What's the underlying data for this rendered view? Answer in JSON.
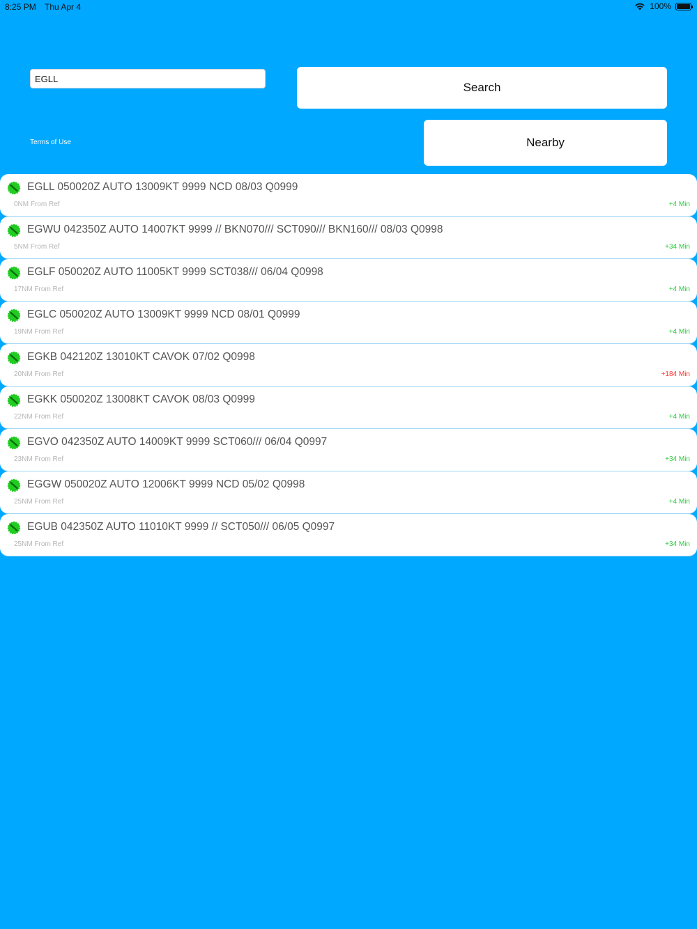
{
  "status": {
    "time": "8:25 PM",
    "date": "Thu Apr 4",
    "battery": "100%"
  },
  "search": {
    "value": "EGLL",
    "button_label": "Search"
  },
  "nearby_label": "Nearby",
  "terms_label": "Terms of Use",
  "colors": {
    "background": "#00a8ff",
    "status_ok": "#22cc22",
    "age_recent": "#2ecc40",
    "age_stale": "#ff3030"
  },
  "stations": [
    {
      "metar": "EGLL 050020Z AUTO 13009KT 9999 NCD 08/03 Q0999",
      "distance": "0NM From Ref",
      "age": "+4 Min",
      "stale": false
    },
    {
      "metar": "EGWU 042350Z AUTO 14007KT 9999 // BKN070/// SCT090/// BKN160/// 08/03 Q0998",
      "distance": "5NM From Ref",
      "age": "+34 Min",
      "stale": false
    },
    {
      "metar": "EGLF 050020Z AUTO 11005KT 9999 SCT038/// 06/04 Q0998",
      "distance": "17NM From Ref",
      "age": "+4 Min",
      "stale": false
    },
    {
      "metar": "EGLC 050020Z AUTO 13009KT 9999 NCD 08/01 Q0999",
      "distance": "19NM From Ref",
      "age": "+4 Min",
      "stale": false
    },
    {
      "metar": "EGKB 042120Z 13010KT CAVOK 07/02 Q0998",
      "distance": "20NM From Ref",
      "age": "+184 Min",
      "stale": true
    },
    {
      "metar": "EGKK 050020Z 13008KT CAVOK 08/03 Q0999",
      "distance": "22NM From Ref",
      "age": "+4 Min",
      "stale": false
    },
    {
      "metar": "EGVO 042350Z AUTO 14009KT 9999 SCT060/// 06/04 Q0997",
      "distance": "23NM From Ref",
      "age": "+34 Min",
      "stale": false
    },
    {
      "metar": "EGGW 050020Z AUTO 12006KT 9999 NCD 05/02 Q0998",
      "distance": "25NM From Ref",
      "age": "+4 Min",
      "stale": false
    },
    {
      "metar": "EGUB 042350Z AUTO 11010KT 9999 // SCT050/// 06/05 Q0997",
      "distance": "25NM From Ref",
      "age": "+34 Min",
      "stale": false
    }
  ]
}
